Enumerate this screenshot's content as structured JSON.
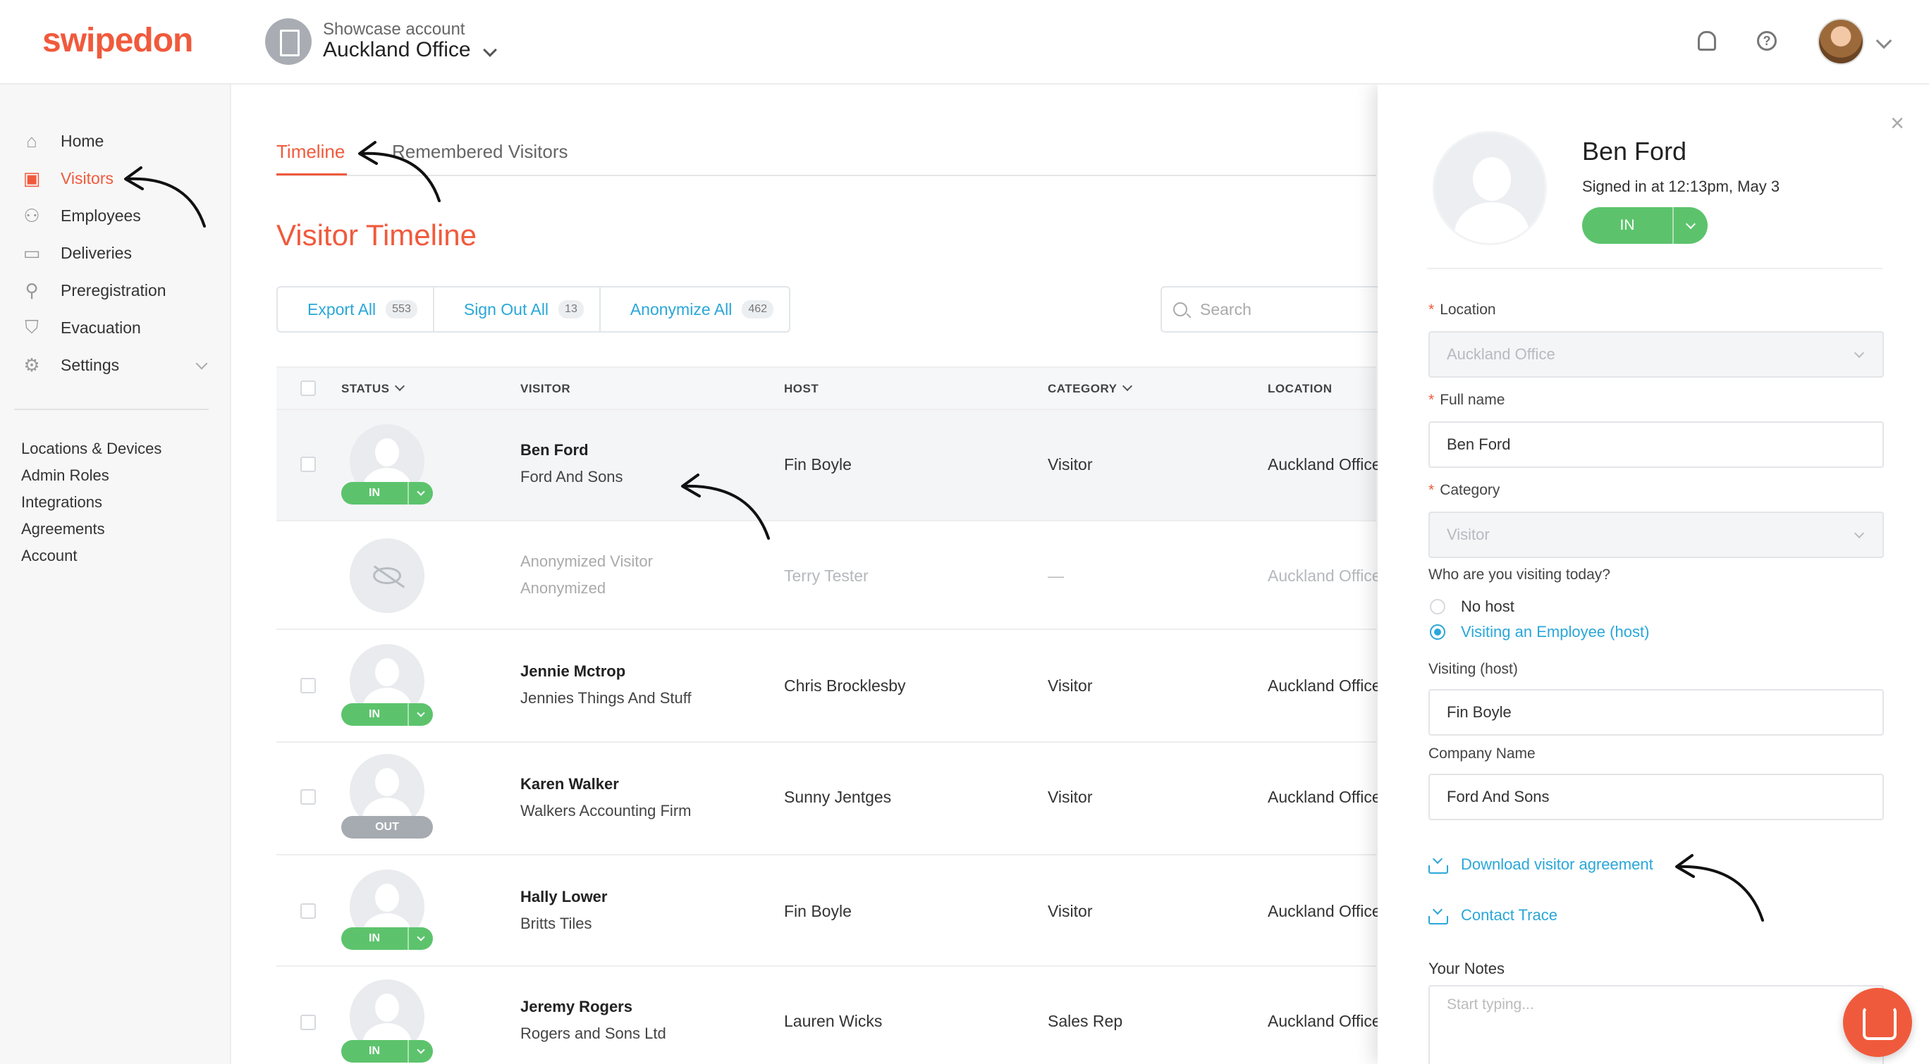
{
  "header": {
    "logo": "swipedon",
    "account_sub": "Showcase account",
    "account_name": "Auckland Office"
  },
  "sidebar": {
    "items": [
      {
        "label": "Home",
        "icon": "home-icon"
      },
      {
        "label": "Visitors",
        "icon": "visitor-card-icon"
      },
      {
        "label": "Employees",
        "icon": "employees-icon"
      },
      {
        "label": "Deliveries",
        "icon": "deliveries-icon"
      },
      {
        "label": "Preregistration",
        "icon": "preregistration-icon"
      },
      {
        "label": "Evacuation",
        "icon": "shield-icon"
      },
      {
        "label": "Settings",
        "icon": "gear-icon"
      }
    ],
    "links": [
      "Locations & Devices",
      "Admin Roles",
      "Integrations",
      "Agreements",
      "Account"
    ]
  },
  "tabs": {
    "timeline": "Timeline",
    "remembered": "Remembered Visitors"
  },
  "page_title": "Visitor Timeline",
  "actions": [
    {
      "label": "Export All",
      "count": "553"
    },
    {
      "label": "Sign Out All",
      "count": "13"
    },
    {
      "label": "Anonymize All",
      "count": "462"
    }
  ],
  "search": {
    "placeholder": "Search"
  },
  "table": {
    "headers": {
      "status": "STATUS",
      "visitor": "VISITOR",
      "host": "HOST",
      "category": "CATEGORY",
      "location": "LOCATION"
    },
    "rows": [
      {
        "name": "Ben Ford",
        "company": "Ford And Sons",
        "host": "Fin Boyle",
        "category": "Visitor",
        "location": "Auckland Office",
        "status": "IN"
      },
      {
        "name": "Anonymized Visitor",
        "company": "Anonymized",
        "host": "Terry Tester",
        "category": "—",
        "location": "Auckland Office",
        "status": ""
      },
      {
        "name": "Jennie Mctrop",
        "company": "Jennies Things And Stuff",
        "host": "Chris Brocklesby",
        "category": "Visitor",
        "location": "Auckland Office",
        "status": "IN"
      },
      {
        "name": "Karen Walker",
        "company": "Walkers Accounting Firm",
        "host": "Sunny Jentges",
        "category": "Visitor",
        "location": "Auckland Office",
        "status": "OUT"
      },
      {
        "name": "Hally Lower",
        "company": "Britts Tiles",
        "host": "Fin Boyle",
        "category": "Visitor",
        "location": "Auckland Office",
        "status": "IN"
      },
      {
        "name": "Jeremy Rogers",
        "company": "Rogers and Sons Ltd",
        "host": "Lauren Wicks",
        "category": "Sales Rep",
        "location": "Auckland Office",
        "status": "IN"
      }
    ]
  },
  "panel": {
    "name": "Ben Ford",
    "signed": "Signed in at 12:13pm, May 3",
    "status": "IN",
    "location_label": "Location",
    "location_value": "Auckland Office",
    "fullname_label": "Full name",
    "fullname_value": "Ben Ford",
    "category_label": "Category",
    "category_value": "Visitor",
    "visiting_question": "Who are you visiting today?",
    "radio_no_host": "No host",
    "radio_employee": "Visiting an Employee (host)",
    "host_label": "Visiting (host)",
    "host_value": "Fin Boyle",
    "company_label": "Company Name",
    "company_value": "Ford And Sons",
    "download_link": "Download visitor agreement",
    "contact_link": "Contact Trace",
    "notes_label": "Your Notes",
    "notes_placeholder": "Start typing..."
  },
  "colors": {
    "accent": "#f05a3c",
    "link": "#2aa7d8",
    "in": "#5cc36c",
    "out": "#a6abb1"
  }
}
